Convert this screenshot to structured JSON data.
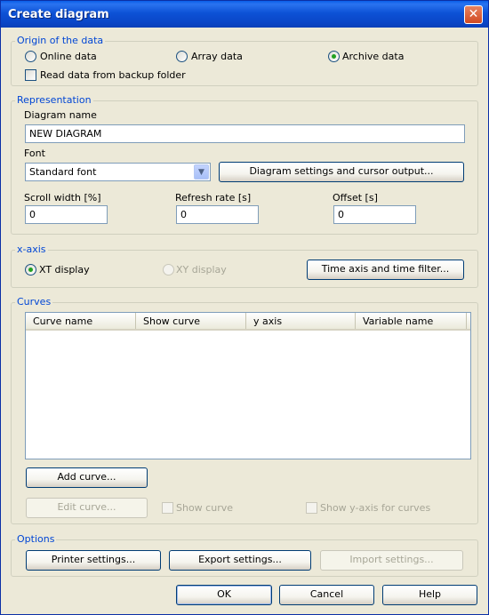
{
  "window": {
    "title": "Create diagram",
    "close_glyph": "✕"
  },
  "origin": {
    "legend": "Origin of the data",
    "online_label": "Online data",
    "array_label": "Array data",
    "archive_label": "Archive data",
    "selected": "archive",
    "backup_label": "Read data from backup folder",
    "backup_checked": false
  },
  "representation": {
    "legend": "Representation",
    "name_label": "Diagram name",
    "name_value": "NEW DIAGRAM",
    "font_label": "Font",
    "font_value": "Standard font",
    "settings_button": "Diagram settings and cursor output...",
    "scroll_label": "Scroll width [%]",
    "scroll_value": "0",
    "refresh_label": "Refresh rate [s]",
    "refresh_value": "0",
    "offset_label": "Offset [s]",
    "offset_value": "0"
  },
  "xaxis": {
    "legend": "x-axis",
    "xt_label": "XT display",
    "xy_label": "XY display",
    "selected": "xt",
    "time_button": "Time axis and time filter..."
  },
  "curves": {
    "legend": "Curves",
    "columns": [
      "Curve name",
      "Show curve",
      "y axis",
      "Variable name"
    ],
    "rows": [],
    "add_button": "Add curve...",
    "edit_button": "Edit curve...",
    "show_curve_label": "Show curve",
    "show_yaxis_label": "Show y-axis for curves"
  },
  "options": {
    "legend": "Options",
    "printer_button": "Printer settings...",
    "export_button": "Export settings...",
    "import_button": "Import settings..."
  },
  "footer": {
    "ok": "OK",
    "cancel": "Cancel",
    "help": "Help"
  },
  "colors": {
    "titlebar": "#0a46c8",
    "legend_text": "#0046d5",
    "dialog_bg": "#ece9d8",
    "radio_dot": "#21a121"
  },
  "icons": {
    "close": "close-icon",
    "dropdown": "chevron-down-icon"
  }
}
